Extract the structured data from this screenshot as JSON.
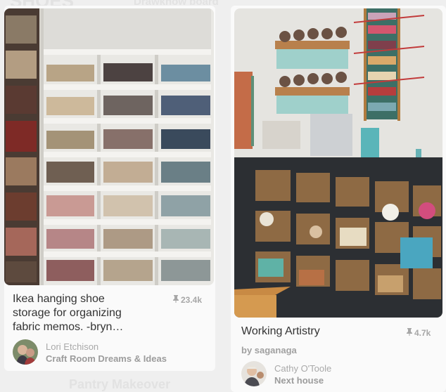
{
  "background_labels": {
    "top_left": "SHOES",
    "top_center": "Drawknow board",
    "bottom": "Pantry Makeover"
  },
  "pins": [
    {
      "title_lines": [
        "Ikea hanging shoe",
        "storage for organizing",
        "fabric memos. -bryn…"
      ],
      "repin_count": "23.4k",
      "repin_icon": "pushpin-icon",
      "pinner_name": "Lori Etchison",
      "board_name": "Craft Room Dreams & Ideas"
    },
    {
      "title": "Working Artistry",
      "repin_count": "4.7k",
      "repin_icon": "pushpin-icon",
      "byline": "by saganaga",
      "pinner_name": "Cathy O'Toole",
      "board_name": "Next house"
    }
  ],
  "colors": {
    "page_bg": "#efefef",
    "card_bg": "#fafafa",
    "title_text": "#333333",
    "muted_text": "#a0a0a0"
  }
}
